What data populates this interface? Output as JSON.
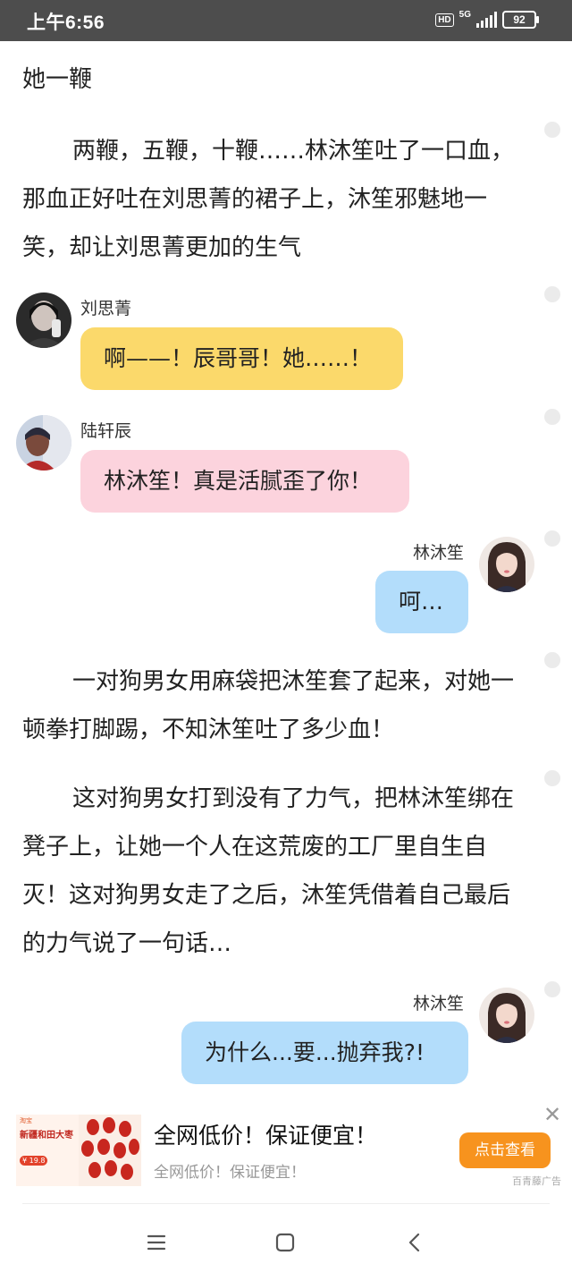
{
  "status_bar": {
    "time": "上午6:56",
    "hd": "HD",
    "network": "5G",
    "battery": "92"
  },
  "story": {
    "top_fragment": "她一鞭",
    "para_1": "两鞭，五鞭，十鞭……林沐笙吐了一口血，那血正好吐在刘思菁的裙子上，沐笙邪魅地一笑，却让刘思菁更加的生气",
    "para_2": "一对狗男女用麻袋把沐笙套了起来，对她一顿拳打脚踢，不知沐笙吐了多少血！",
    "para_3": "这对狗男女打到没有了力气，把林沐笙绑在凳子上，让她一个人在这荒废的工厂里自生自灭！这对狗男女走了之后，沐笙凭借着自己最后的力气说了一句话…"
  },
  "messages": [
    {
      "speaker": "刘思菁",
      "text": "啊——！辰哥哥！她……！",
      "bubble_color": "#fbd96b"
    },
    {
      "speaker": "陆轩辰",
      "text": "林沐笙！真是活腻歪了你！",
      "bubble_color": "#fcd3dd"
    },
    {
      "speaker": "林沐笙",
      "text": "呵…",
      "bubble_color": "#b3ddfb"
    },
    {
      "speaker": "林沐笙",
      "text": "为什么...要...抛弃我?!",
      "bubble_color": "#b3ddfb"
    }
  ],
  "ad": {
    "title": "全网低价！保证便宜！",
    "subtitle": "全网低价！保证便宜！",
    "button": "点击查看",
    "source": "百青藤广告",
    "image_caption": "新疆和田大枣",
    "image_brand": "淘宝",
    "image_price": "¥ 19.8",
    "accent_color": "#f7931e"
  },
  "icons": [
    "menu-icon",
    "home-square-icon",
    "back-chevron-icon",
    "close-icon",
    "bubble-dot-icon"
  ]
}
